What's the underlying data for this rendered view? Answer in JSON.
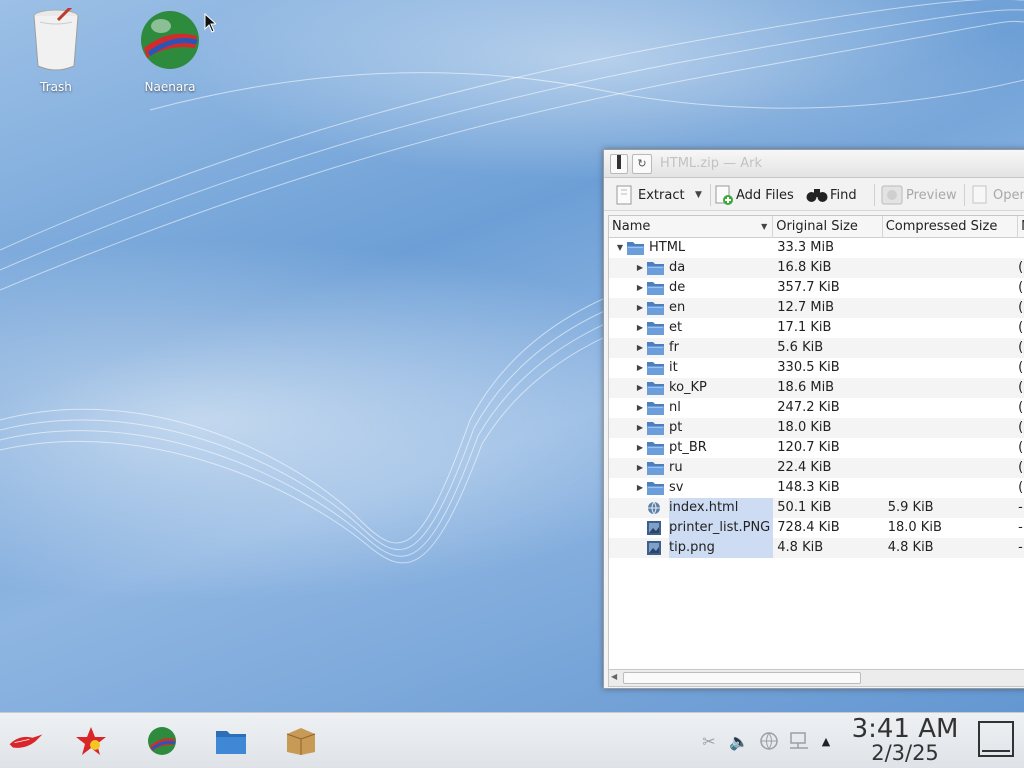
{
  "desktop": {
    "icons": [
      {
        "label": "Trash"
      },
      {
        "label": "Naenara"
      }
    ]
  },
  "window": {
    "title": "HTML.zip — Ark",
    "toolbar": {
      "extract": "Extract",
      "add_files": "Add Files",
      "find": "Find",
      "preview": "Preview",
      "open": "Open"
    },
    "columns": [
      "Name",
      "Original Size",
      "Compressed Size",
      "M"
    ],
    "rows": [
      {
        "name": "HTML",
        "original": "33.3 MiB",
        "compressed": "",
        "more": "",
        "type": "folder",
        "expanded": true,
        "level": 0
      },
      {
        "name": "da",
        "original": "16.8 KiB",
        "compressed": "",
        "more": "(",
        "type": "folder",
        "level": 1
      },
      {
        "name": "de",
        "original": "357.7 KiB",
        "compressed": "",
        "more": "(",
        "type": "folder",
        "level": 1
      },
      {
        "name": "en",
        "original": "12.7 MiB",
        "compressed": "",
        "more": "(",
        "type": "folder",
        "level": 1
      },
      {
        "name": "et",
        "original": "17.1 KiB",
        "compressed": "",
        "more": "(",
        "type": "folder",
        "level": 1
      },
      {
        "name": "fr",
        "original": "5.6 KiB",
        "compressed": "",
        "more": "(",
        "type": "folder",
        "level": 1
      },
      {
        "name": "it",
        "original": "330.5 KiB",
        "compressed": "",
        "more": "(",
        "type": "folder",
        "level": 1
      },
      {
        "name": "ko_KP",
        "original": "18.6 MiB",
        "compressed": "",
        "more": "(",
        "type": "folder",
        "level": 1
      },
      {
        "name": "nl",
        "original": "247.2 KiB",
        "compressed": "",
        "more": "(",
        "type": "folder",
        "level": 1
      },
      {
        "name": "pt",
        "original": "18.0 KiB",
        "compressed": "",
        "more": "(",
        "type": "folder",
        "level": 1
      },
      {
        "name": "pt_BR",
        "original": "120.7 KiB",
        "compressed": "",
        "more": "(",
        "type": "folder",
        "level": 1
      },
      {
        "name": "ru",
        "original": "22.4 KiB",
        "compressed": "",
        "more": "(",
        "type": "folder",
        "level": 1
      },
      {
        "name": "sv",
        "original": "148.3 KiB",
        "compressed": "",
        "more": "(",
        "type": "folder",
        "level": 1
      },
      {
        "name": "index.html",
        "original": "50.1 KiB",
        "compressed": "5.9 KiB",
        "more": "-",
        "type": "html",
        "level": 1,
        "selected": true
      },
      {
        "name": "printer_list.PNG",
        "original": "728.4 KiB",
        "compressed": "18.0 KiB",
        "more": "-",
        "type": "image",
        "level": 1,
        "selected": true
      },
      {
        "name": "tip.png",
        "original": "4.8 KiB",
        "compressed": "4.8 KiB",
        "more": "-",
        "type": "image",
        "level": 1,
        "selected": true
      }
    ]
  },
  "taskbar": {
    "apps": [
      "application-menu-icon",
      "star-app-icon",
      "browser-globe-icon",
      "file-manager-icon",
      "archive-box-icon"
    ],
    "tray": [
      "scissors-icon",
      "volume-icon",
      "network-globe-icon",
      "display-icon",
      "tray-expand-icon"
    ],
    "time": "3:41 AM",
    "date": "2/3/25"
  },
  "colors": {
    "selection": "#cddcf3",
    "folder": "#5a8fcf"
  }
}
